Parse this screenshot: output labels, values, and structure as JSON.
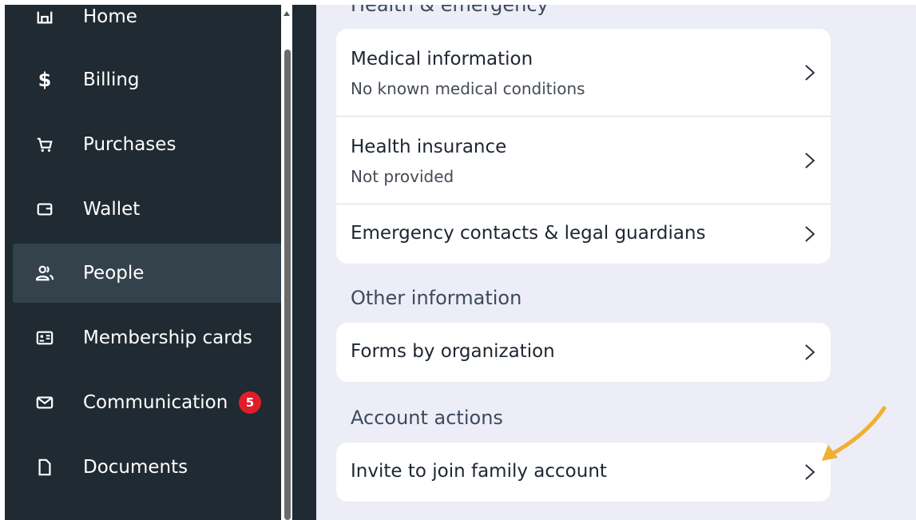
{
  "sidebar": {
    "items": [
      {
        "label": "Home",
        "icon": "home-icon"
      },
      {
        "label": "Billing",
        "icon": "dollar-icon"
      },
      {
        "label": "Purchases",
        "icon": "cart-icon"
      },
      {
        "label": "Wallet",
        "icon": "wallet-icon"
      },
      {
        "label": "People",
        "icon": "people-icon",
        "active": true
      },
      {
        "label": "Membership cards",
        "icon": "id-card-icon"
      },
      {
        "label": "Communication",
        "icon": "mail-icon",
        "badge": "5"
      },
      {
        "label": "Documents",
        "icon": "document-icon"
      }
    ]
  },
  "main": {
    "top_section": "Health & emergency",
    "health_rows": [
      {
        "title": "Medical information",
        "subtitle": "No known medical conditions"
      },
      {
        "title": "Health insurance",
        "subtitle": "Not provided"
      },
      {
        "title": "Emergency contacts & legal guardians"
      }
    ],
    "other_section": "Other information",
    "other_rows": [
      {
        "title": "Forms by organization"
      }
    ],
    "account_section": "Account actions",
    "account_rows": [
      {
        "title": "Invite to join family account"
      }
    ]
  },
  "colors": {
    "sidebar_bg": "#1f2a32",
    "sidebar_active": "#34424c",
    "main_bg": "#ecedf6",
    "badge": "#e11d2a",
    "annotation_arrow": "#f0b030"
  }
}
